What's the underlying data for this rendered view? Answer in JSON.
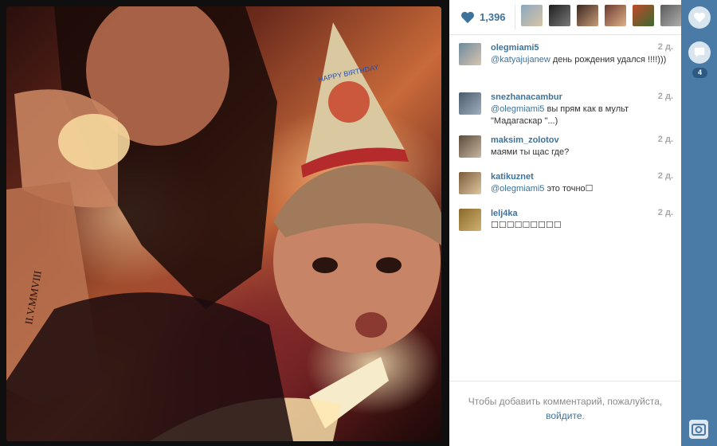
{
  "photo": {
    "tattoo_text": "II.V.MMVIII",
    "hat_text": "HAPPY BIRTHDAY"
  },
  "likes": {
    "count": "1,396",
    "heart_icon": "heart-icon"
  },
  "comments": [
    {
      "user": "olegmiami5",
      "time": "2 д.",
      "mention": "@katyajujanew",
      "text": " день рождения удался !!!!)))"
    },
    {
      "user": "snezhanacambur",
      "time": "2 д.",
      "mention": "@olegmiami5",
      "text": " вы прям как в мульт \"Мадагаскар \"...)"
    },
    {
      "user": "maksim_zolotov",
      "time": "2 д.",
      "mention": "",
      "text": "маями ты щас где?"
    },
    {
      "user": "katikuznet",
      "time": "2 д.",
      "mention": "@olegmiami5",
      "text": " это точно☐"
    },
    {
      "user": "lelj4ka",
      "time": "2 д.",
      "mention": "",
      "text": "☐☐☐☐☐☐☐☐☐"
    }
  ],
  "login": {
    "text": "Чтобы добавить комментарий, пожалуйста,",
    "link": "войдите",
    "after": "."
  },
  "rail": {
    "comment_badge": "4"
  },
  "colors": {
    "link": "#3f729b",
    "rail": "#4a7ba6"
  }
}
